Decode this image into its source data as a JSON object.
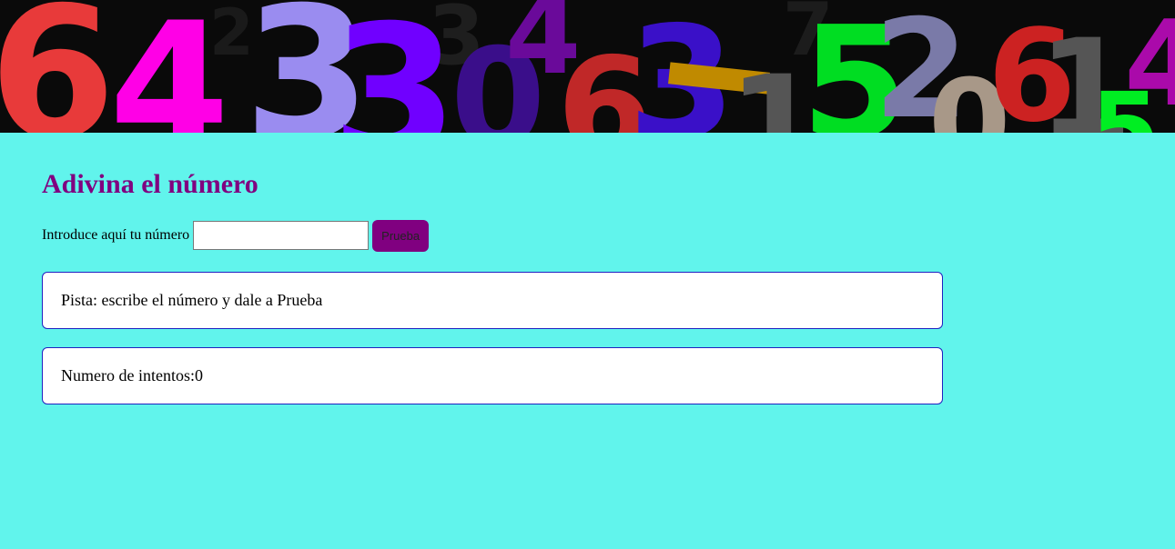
{
  "page": {
    "title": "Adivina el número",
    "background_color": "#61f4ec",
    "title_color": "#800080"
  },
  "form": {
    "label": "Introduce aquí tu número",
    "input_value": "",
    "button_label": "Prueba",
    "button_color": "#800080"
  },
  "hint": {
    "text": "Pista: escribe el número y dale a Prueba"
  },
  "attempts": {
    "label": "Numero de intentos:",
    "count": "0"
  }
}
